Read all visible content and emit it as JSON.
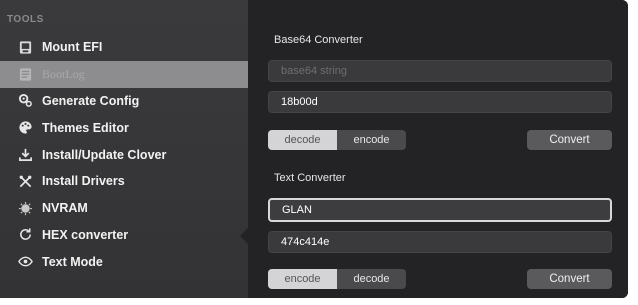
{
  "sidebar": {
    "section_title": "TOOLS",
    "items": [
      {
        "label": "Mount EFI",
        "icon": "disk-icon"
      },
      {
        "label": "BootLog",
        "icon": "log-icon"
      },
      {
        "label": "Generate Config",
        "icon": "gears-icon"
      },
      {
        "label": "Themes Editor",
        "icon": "palette-icon"
      },
      {
        "label": "Install/Update Clover",
        "icon": "download-icon"
      },
      {
        "label": "Install Drivers",
        "icon": "tools-icon"
      },
      {
        "label": "NVRAM",
        "icon": "chip-icon"
      },
      {
        "label": "HEX converter",
        "icon": "refresh-icon"
      },
      {
        "label": "Text Mode",
        "icon": "eye-icon"
      }
    ],
    "selected_index": 1
  },
  "base64": {
    "title": "Base64 Converter",
    "input_placeholder": "base64 string",
    "output_value": "18b00d",
    "segments": [
      "decode",
      "encode"
    ],
    "active_segment": "decode",
    "convert_label": "Convert"
  },
  "text": {
    "title": "Text Converter",
    "input_value": "GLAN",
    "output_value": "474c414e",
    "segments": [
      "encode",
      "decode"
    ],
    "active_segment": "encode",
    "convert_label": "Convert"
  }
}
